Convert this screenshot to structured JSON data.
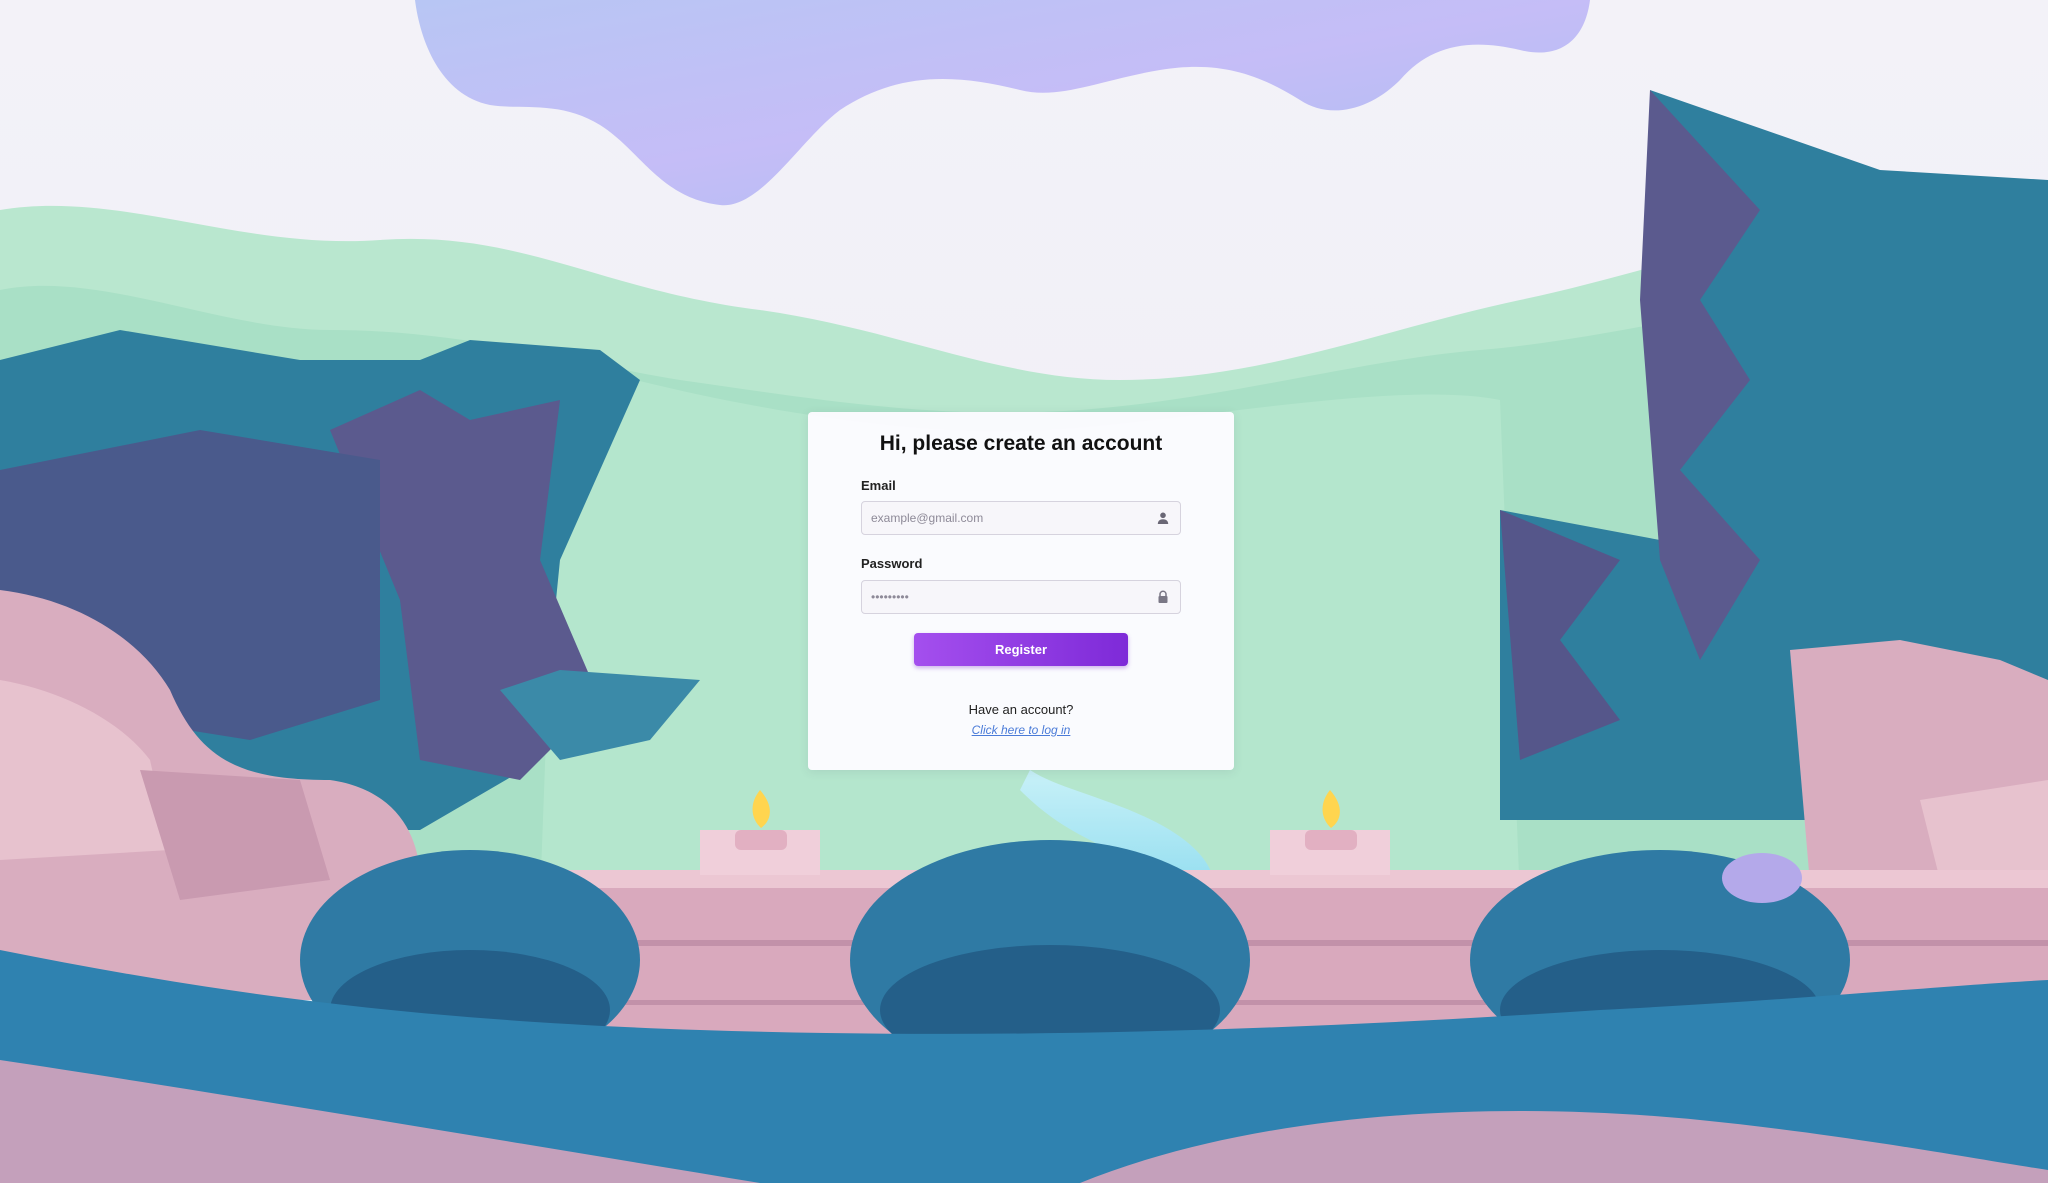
{
  "form": {
    "title": "Hi, please create an account",
    "email_label": "Email",
    "email_placeholder": "example@gmail.com",
    "email_value": "",
    "password_label": "Password",
    "password_placeholder": "•••••••••",
    "password_value": "",
    "register_label": "Register",
    "have_account_text": "Have an account?",
    "login_link_text": "Click here to log in"
  },
  "icons": {
    "email_field": "user-icon",
    "password_field": "lock-icon"
  },
  "colors": {
    "accent_start": "#a44fee",
    "accent_end": "#7e2ad8",
    "link": "#4a7bd8"
  }
}
